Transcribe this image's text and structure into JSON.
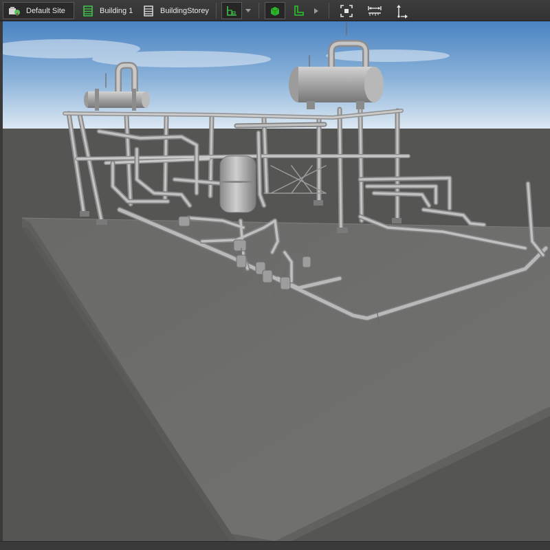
{
  "breadcrumbs": [
    {
      "label": "Default Site",
      "icon": "site-icon",
      "active": true
    },
    {
      "label": "Building 1",
      "icon": "building-icon",
      "active": false
    },
    {
      "label": "BuildingStorey",
      "icon": "building-storey-icon",
      "active": false
    }
  ],
  "toolbar": {
    "tools": [
      {
        "icon": "plan-view-icon",
        "state": "selected"
      },
      {
        "icon": "dropdown-arrow-icon"
      },
      {
        "icon": "solid-box-icon",
        "state": "selected",
        "color": "#2db42d"
      },
      {
        "icon": "section-profile-icon",
        "color": "#2db42d"
      },
      {
        "icon": "expand-arrow-icon"
      },
      {
        "icon": "fit-view-icon"
      },
      {
        "icon": "measure-distance-icon"
      },
      {
        "icon": "measure-height-icon"
      }
    ]
  },
  "viewport": {
    "scene": "3D model of piping skid with vessels, pipe racks and valves",
    "colors": {
      "sky_top": "#4d86c4",
      "sky_horizon": "#d9e7f3",
      "ground": "#555553",
      "slab": "#6d6d6b",
      "model": "#a8a8a8"
    }
  }
}
